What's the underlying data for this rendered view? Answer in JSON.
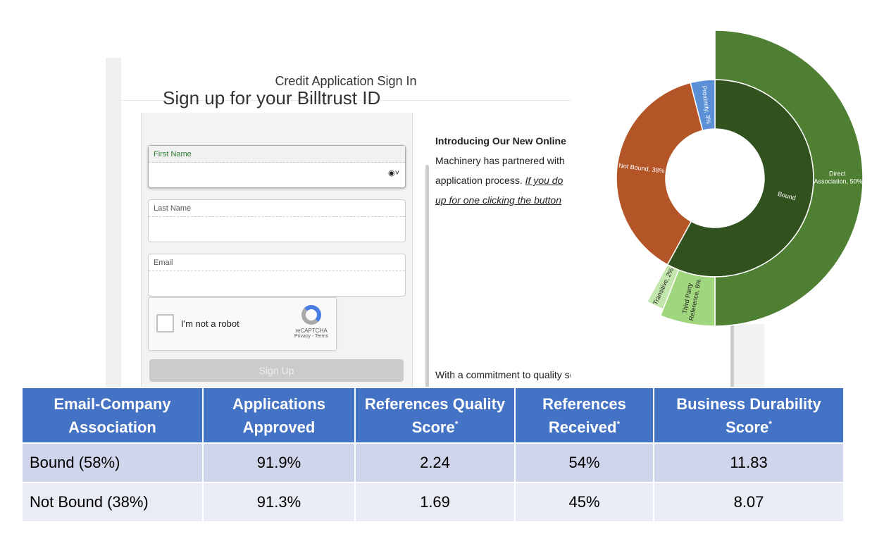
{
  "app": {
    "title": "Credit Application Sign In",
    "form_heading_cut": "Sign up for your Billtrust ID",
    "fields": [
      {
        "label": "First Name",
        "value": ""
      },
      {
        "label": "Last Name",
        "value": ""
      },
      {
        "label": "Email",
        "value": ""
      }
    ],
    "autofill_icon": "person-circle-icon",
    "captcha": {
      "label": "I'm not a robot",
      "brand": "reCAPTCHA",
      "links": "Privacy - Terms"
    },
    "signup_label": "Sign Up",
    "intro_heading": "Introducing Our New Online",
    "intro_line1": "Machinery has partnered with",
    "intro_line2": "application process. ",
    "intro_link1": "If you do",
    "intro_link2": "up for one clicking the button",
    "bottom_text": "With a commitment to quality service, competitive pricing, and"
  },
  "chart_data": {
    "type": "sunburst",
    "inner_ring": [
      {
        "label": "Bound",
        "value": 58,
        "color": "#31521F"
      },
      {
        "label": "Not Bound, 38%",
        "value": 38,
        "color": "#B35527"
      },
      {
        "label": "Proximity, 3%",
        "value": 4,
        "color": "#5B8FD6"
      }
    ],
    "outer_ring": [
      {
        "label": "Direct Association, 50%",
        "value": 50,
        "color": "#4E7F32"
      },
      {
        "label": "Third Party Reference, 6%",
        "value": 6,
        "color": "#A0D67E"
      },
      {
        "label": "Transitive, 2%",
        "value": 2,
        "color": "#C3E6AC"
      }
    ]
  },
  "table": {
    "headers": [
      "Email-Company Association",
      "Applications Approved",
      "References Quality Score",
      "References Received",
      "Business Durability Score"
    ],
    "header_marks": [
      "",
      "",
      "*",
      "*",
      "*"
    ],
    "rows": [
      [
        "Bound (58%)",
        "91.9%",
        "2.24",
        "54%",
        "11.83"
      ],
      [
        "Not Bound (38%)",
        "91.3%",
        "1.69",
        "45%",
        "8.07"
      ]
    ],
    "header_color": "#4472C4"
  }
}
